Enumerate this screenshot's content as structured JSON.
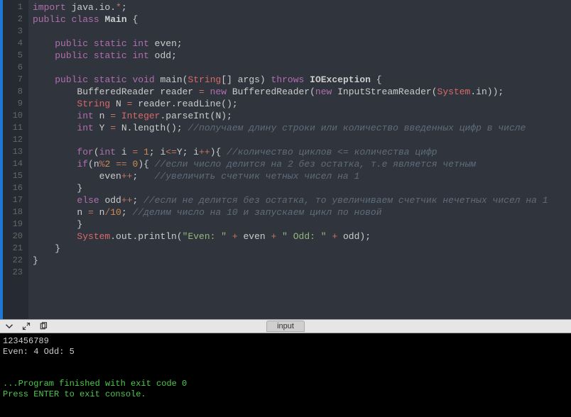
{
  "editor": {
    "lines": [
      {
        "n": 1,
        "tokens": [
          {
            "c": "kw",
            "t": "import"
          },
          {
            "c": "pl",
            "t": " java.io."
          },
          {
            "c": "op",
            "t": "*"
          },
          {
            "c": "pl",
            "t": ";"
          }
        ]
      },
      {
        "n": 2,
        "tokens": [
          {
            "c": "kw",
            "t": "public"
          },
          {
            "c": "pl",
            "t": " "
          },
          {
            "c": "kw",
            "t": "class"
          },
          {
            "c": "pl",
            "t": " "
          },
          {
            "c": "pl bold",
            "t": "Main"
          },
          {
            "c": "pl",
            "t": " {"
          }
        ]
      },
      {
        "n": 3,
        "tokens": []
      },
      {
        "n": 4,
        "tokens": [
          {
            "c": "pl",
            "t": "    "
          },
          {
            "c": "kw",
            "t": "public"
          },
          {
            "c": "pl",
            "t": " "
          },
          {
            "c": "kw",
            "t": "static"
          },
          {
            "c": "pl",
            "t": " "
          },
          {
            "c": "kw",
            "t": "int"
          },
          {
            "c": "pl",
            "t": " even;"
          }
        ]
      },
      {
        "n": 5,
        "tokens": [
          {
            "c": "pl",
            "t": "    "
          },
          {
            "c": "kw",
            "t": "public"
          },
          {
            "c": "pl",
            "t": " "
          },
          {
            "c": "kw",
            "t": "static"
          },
          {
            "c": "pl",
            "t": " "
          },
          {
            "c": "kw",
            "t": "int"
          },
          {
            "c": "pl",
            "t": " odd;"
          }
        ]
      },
      {
        "n": 6,
        "tokens": []
      },
      {
        "n": 7,
        "tokens": [
          {
            "c": "pl",
            "t": "    "
          },
          {
            "c": "kw",
            "t": "public"
          },
          {
            "c": "pl",
            "t": " "
          },
          {
            "c": "kw",
            "t": "static"
          },
          {
            "c": "pl",
            "t": " "
          },
          {
            "c": "kw",
            "t": "void"
          },
          {
            "c": "pl",
            "t": " main("
          },
          {
            "c": "type",
            "t": "String"
          },
          {
            "c": "pl",
            "t": "[] args) "
          },
          {
            "c": "kw",
            "t": "throws"
          },
          {
            "c": "pl",
            "t": " "
          },
          {
            "c": "pl bold",
            "t": "IOException"
          },
          {
            "c": "pl",
            "t": " {"
          }
        ]
      },
      {
        "n": 8,
        "tokens": [
          {
            "c": "pl",
            "t": "        BufferedReader reader "
          },
          {
            "c": "op",
            "t": "="
          },
          {
            "c": "pl",
            "t": " "
          },
          {
            "c": "kw",
            "t": "new"
          },
          {
            "c": "pl",
            "t": " BufferedReader("
          },
          {
            "c": "kw",
            "t": "new"
          },
          {
            "c": "pl",
            "t": " InputStreamReader("
          },
          {
            "c": "type",
            "t": "System"
          },
          {
            "c": "pl",
            "t": ".in));"
          }
        ]
      },
      {
        "n": 9,
        "tokens": [
          {
            "c": "pl",
            "t": "        "
          },
          {
            "c": "type",
            "t": "String"
          },
          {
            "c": "pl",
            "t": " N "
          },
          {
            "c": "op",
            "t": "="
          },
          {
            "c": "pl",
            "t": " reader.readLine();"
          }
        ]
      },
      {
        "n": 10,
        "tokens": [
          {
            "c": "pl",
            "t": "        "
          },
          {
            "c": "kw",
            "t": "int"
          },
          {
            "c": "pl",
            "t": " n "
          },
          {
            "c": "op",
            "t": "="
          },
          {
            "c": "pl",
            "t": " "
          },
          {
            "c": "type",
            "t": "Integer"
          },
          {
            "c": "pl",
            "t": ".parseInt(N);"
          }
        ]
      },
      {
        "n": 11,
        "tokens": [
          {
            "c": "pl",
            "t": "        "
          },
          {
            "c": "kw",
            "t": "int"
          },
          {
            "c": "pl",
            "t": " Y "
          },
          {
            "c": "op",
            "t": "="
          },
          {
            "c": "pl",
            "t": " N.length(); "
          },
          {
            "c": "cm",
            "t": "//получаем длину строки или количество введенных цифр в числе"
          }
        ]
      },
      {
        "n": 12,
        "tokens": []
      },
      {
        "n": 13,
        "tokens": [
          {
            "c": "pl",
            "t": "        "
          },
          {
            "c": "kw",
            "t": "for"
          },
          {
            "c": "pl",
            "t": "("
          },
          {
            "c": "kw",
            "t": "int"
          },
          {
            "c": "pl",
            "t": " i "
          },
          {
            "c": "op",
            "t": "="
          },
          {
            "c": "pl",
            "t": " "
          },
          {
            "c": "num",
            "t": "1"
          },
          {
            "c": "pl",
            "t": "; i"
          },
          {
            "c": "op",
            "t": "<="
          },
          {
            "c": "pl",
            "t": "Y; i"
          },
          {
            "c": "op",
            "t": "++"
          },
          {
            "c": "pl",
            "t": "){ "
          },
          {
            "c": "cm",
            "t": "//количество циклов <= количества цифр"
          }
        ]
      },
      {
        "n": 14,
        "tokens": [
          {
            "c": "pl",
            "t": "        "
          },
          {
            "c": "kw",
            "t": "if"
          },
          {
            "c": "pl",
            "t": "(n"
          },
          {
            "c": "op",
            "t": "%"
          },
          {
            "c": "num",
            "t": "2"
          },
          {
            "c": "pl",
            "t": " "
          },
          {
            "c": "op",
            "t": "=="
          },
          {
            "c": "pl",
            "t": " "
          },
          {
            "c": "num",
            "t": "0"
          },
          {
            "c": "pl",
            "t": "){ "
          },
          {
            "c": "cm",
            "t": "//если число делится на 2 без остатка, т.е является четным"
          }
        ]
      },
      {
        "n": 15,
        "tokens": [
          {
            "c": "pl",
            "t": "            even"
          },
          {
            "c": "op",
            "t": "++"
          },
          {
            "c": "pl",
            "t": ";   "
          },
          {
            "c": "cm",
            "t": "//увеличить счетчик четных чисел на 1"
          }
        ]
      },
      {
        "n": 16,
        "tokens": [
          {
            "c": "pl",
            "t": "        }"
          }
        ]
      },
      {
        "n": 17,
        "tokens": [
          {
            "c": "pl",
            "t": "        "
          },
          {
            "c": "kw",
            "t": "else"
          },
          {
            "c": "pl",
            "t": " odd"
          },
          {
            "c": "op",
            "t": "++"
          },
          {
            "c": "pl",
            "t": "; "
          },
          {
            "c": "cm",
            "t": "//если не делится без остатка, то увеличиваем счетчик нечетных чисел на 1"
          }
        ]
      },
      {
        "n": 18,
        "tokens": [
          {
            "c": "pl",
            "t": "        n "
          },
          {
            "c": "op",
            "t": "="
          },
          {
            "c": "pl",
            "t": " n"
          },
          {
            "c": "op",
            "t": "/"
          },
          {
            "c": "num",
            "t": "10"
          },
          {
            "c": "pl",
            "t": "; "
          },
          {
            "c": "cm",
            "t": "//делим число на 10 и запускаем цикл по новой"
          }
        ]
      },
      {
        "n": 19,
        "tokens": [
          {
            "c": "pl",
            "t": "        }"
          }
        ]
      },
      {
        "n": 20,
        "tokens": [
          {
            "c": "pl",
            "t": "        "
          },
          {
            "c": "type",
            "t": "System"
          },
          {
            "c": "pl",
            "t": ".out.println("
          },
          {
            "c": "str",
            "t": "\"Even: \""
          },
          {
            "c": "pl",
            "t": " "
          },
          {
            "c": "op",
            "t": "+"
          },
          {
            "c": "pl",
            "t": " even "
          },
          {
            "c": "op",
            "t": "+"
          },
          {
            "c": "pl",
            "t": " "
          },
          {
            "c": "str",
            "t": "\" Odd: \""
          },
          {
            "c": "pl",
            "t": " "
          },
          {
            "c": "op",
            "t": "+"
          },
          {
            "c": "pl",
            "t": " odd);"
          }
        ]
      },
      {
        "n": 21,
        "tokens": [
          {
            "c": "pl",
            "t": "    }"
          }
        ]
      },
      {
        "n": 22,
        "tokens": [
          {
            "c": "pl",
            "t": "}"
          }
        ]
      },
      {
        "n": 23,
        "tokens": []
      }
    ]
  },
  "panel": {
    "tab_label": "input"
  },
  "console": {
    "lines": [
      {
        "c": "",
        "t": "123456789"
      },
      {
        "c": "",
        "t": "Even: 4 Odd: 5"
      },
      {
        "c": "",
        "t": ""
      },
      {
        "c": "",
        "t": ""
      },
      {
        "c": "grn",
        "t": "...Program finished with exit code 0"
      },
      {
        "c": "grn",
        "t": "Press ENTER to exit console."
      }
    ]
  }
}
